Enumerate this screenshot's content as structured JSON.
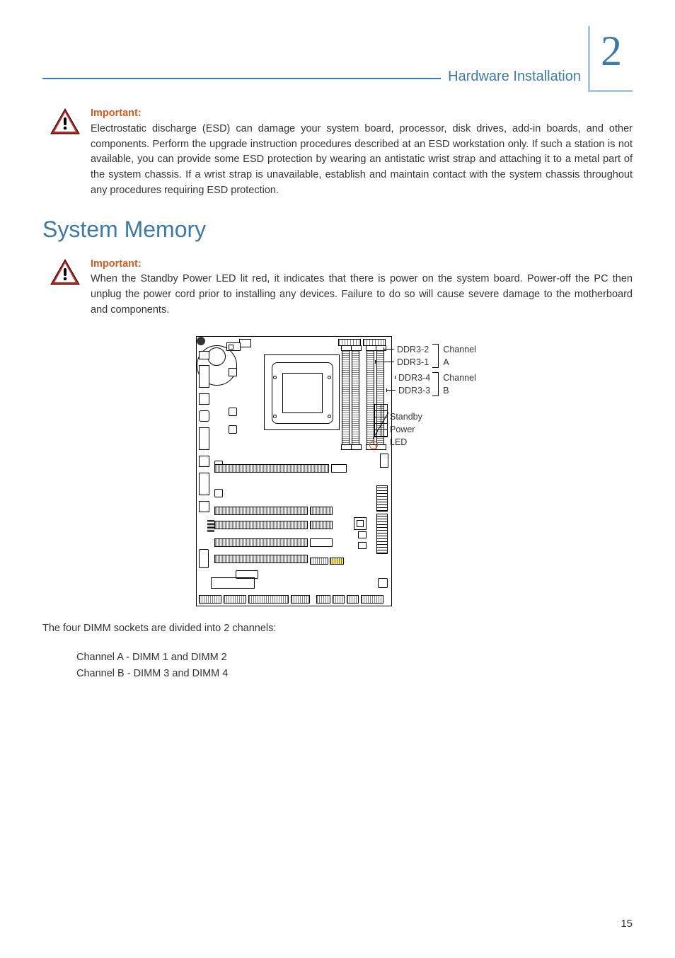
{
  "header": {
    "section_title": "Hardware Installation",
    "chapter_number": "2"
  },
  "block1": {
    "label": "Important:",
    "text": "Electrostatic discharge (ESD) can damage your system board, processor, disk drives, add-in boards, and other components. Perform the upgrade instruction procedures described at an ESD workstation only. If such a station is not available, you can provide some ESD protection by wearing an antistatic wrist strap and attaching it to a metal part of the system chassis. If a wrist strap is unavailable, establish and maintain contact with the system chassis throughout any procedures requiring ESD protection."
  },
  "section": {
    "title": "System Memory"
  },
  "block2": {
    "label": "Important:",
    "text": "When the Standby Power LED lit red, it indicates that there is power on the system board. Power-off the PC then unplug the power cord prior to installing any devices. Failure to do so will cause severe damage to the motherboard and components."
  },
  "diagram": {
    "ddr3_2": "DDR3-2",
    "ddr3_1": "DDR3-1",
    "ddr3_4": "DDR3-4",
    "ddr3_3": "DDR3-3",
    "channel_a": "Channel A",
    "channel_b": "Channel B",
    "standby_led_line1": "Standby",
    "standby_led_line2": "Power LED"
  },
  "body": {
    "intro": "The four DIMM sockets are divided into 2 channels:",
    "line1": "Channel A - DIMM 1 and DIMM 2",
    "line2": "Channel B - DIMM 3 and DIMM 4"
  },
  "page_number": "15"
}
